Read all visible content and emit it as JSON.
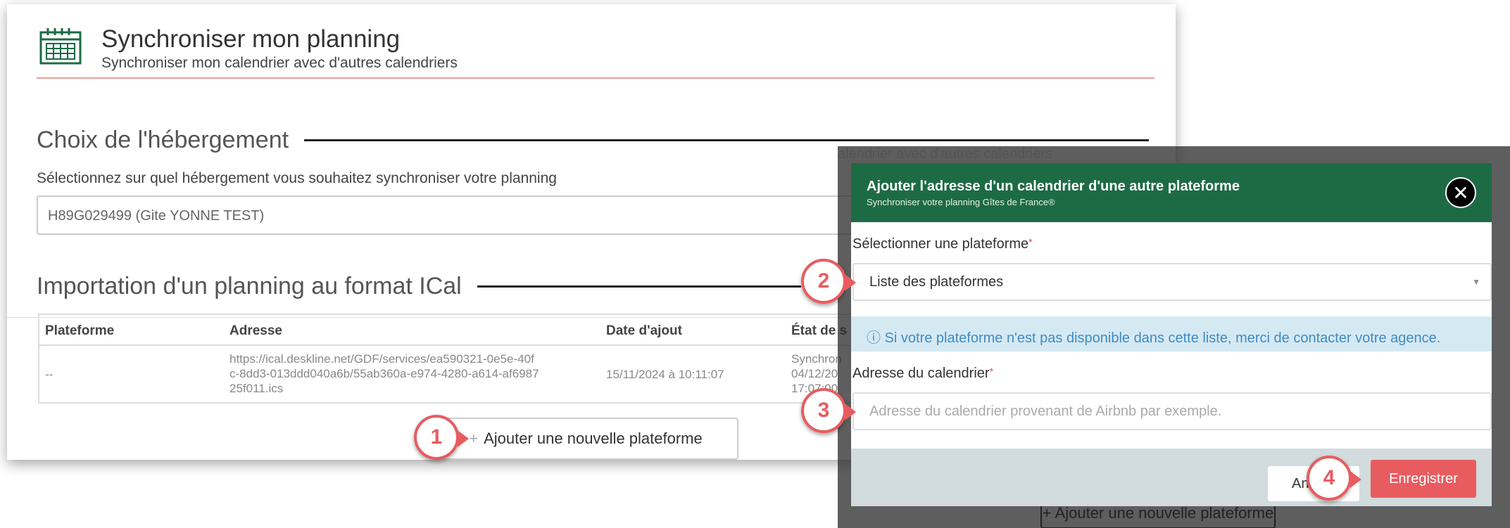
{
  "header": {
    "title": "Synchroniser mon planning",
    "subtitle": "Synchroniser mon calendrier avec d'autres calendriers"
  },
  "accommodation": {
    "section_title": "Choix de l'hébergement",
    "help": "Sélectionnez sur quel hébergement vous souhaitez synchroniser votre planning",
    "selected": "H89G029499 (Gite YONNE TEST)"
  },
  "import": {
    "section_title": "Importation d'un planning au format ICal",
    "columns": [
      "Plateforme",
      "Adresse",
      "Date d'ajout",
      "État de s"
    ],
    "row": {
      "platform": "--",
      "address_1": "https://ical.deskline.net/GDF/services/ea590321-0e5e-40f",
      "address_2": "c-8dd3-013ddd040a6b/55ab360a-e974-4280-a614-af6987",
      "address_3": "25f011.ics",
      "date": "15/11/2024 à 10:11:07",
      "state_1": "Synchron",
      "state_2": "04/12/20",
      "state_3": "17:07:00"
    },
    "add_button": "Ajouter une nouvelle plateforme"
  },
  "backdrop": {
    "text": "alendrier avec d'autres calendriers",
    "button": "+ Ajouter une nouvelle plateforme"
  },
  "modal": {
    "title": "Ajouter l'adresse d'un calendrier d'une autre plateforme",
    "subtitle": "Synchroniser votre planning Gîtes de France®",
    "close": "✕",
    "platform_label": "Sélectionner une plateforme",
    "platform_value": "Liste des plateformes",
    "info": "ⓘ Si votre plateforme n'est pas disponible dans cette liste, merci de contacter votre agence.",
    "address_label": "Adresse du calendrier",
    "address_placeholder": "Adresse du calendrier provenant de Airbnb par exemple.",
    "cancel": "An",
    "save": "Enregistrer"
  },
  "badges": [
    "1",
    "2",
    "3",
    "4"
  ],
  "colors": {
    "accent": "#e85c5f",
    "header_green": "#1d6b44",
    "info_blue": "#3f8cc4"
  },
  "icons": [
    "calendar-icon",
    "close-icon",
    "chevron-down-icon",
    "plus-icon"
  ]
}
